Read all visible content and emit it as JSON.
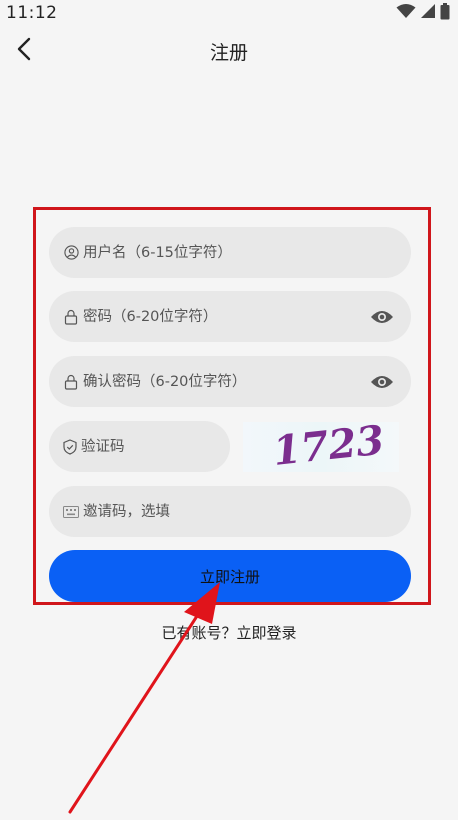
{
  "status_bar": {
    "time": "11:12",
    "icons": [
      "wifi-icon",
      "signal-icon",
      "battery-icon"
    ]
  },
  "header": {
    "title": "注册",
    "back_icon": "chevron-left-icon"
  },
  "form": {
    "username": {
      "placeholder": "用户名（6-15位字符）",
      "icon": "user-circle-icon"
    },
    "password": {
      "placeholder": "密码（6-20位字符）",
      "icon": "lock-icon",
      "toggle_icon": "eye-icon"
    },
    "confirm_password": {
      "placeholder": "确认密码（6-20位字符）",
      "icon": "lock-icon",
      "toggle_icon": "eye-icon"
    },
    "captcha": {
      "placeholder": "验证码",
      "icon": "shield-icon",
      "image_text": "1723"
    },
    "invite_code": {
      "placeholder": "邀请码，选填",
      "icon": "keyboard-icon"
    },
    "submit_label": "立即注册"
  },
  "footer": {
    "have_account": "已有账号？",
    "login_link": "立即登录"
  },
  "colors": {
    "primary": "#0a60f5",
    "annotation_red": "#d0161b",
    "field_bg": "#e8e8e8",
    "page_bg": "#f5f5f5",
    "captcha_text": "#7b2d8e"
  }
}
